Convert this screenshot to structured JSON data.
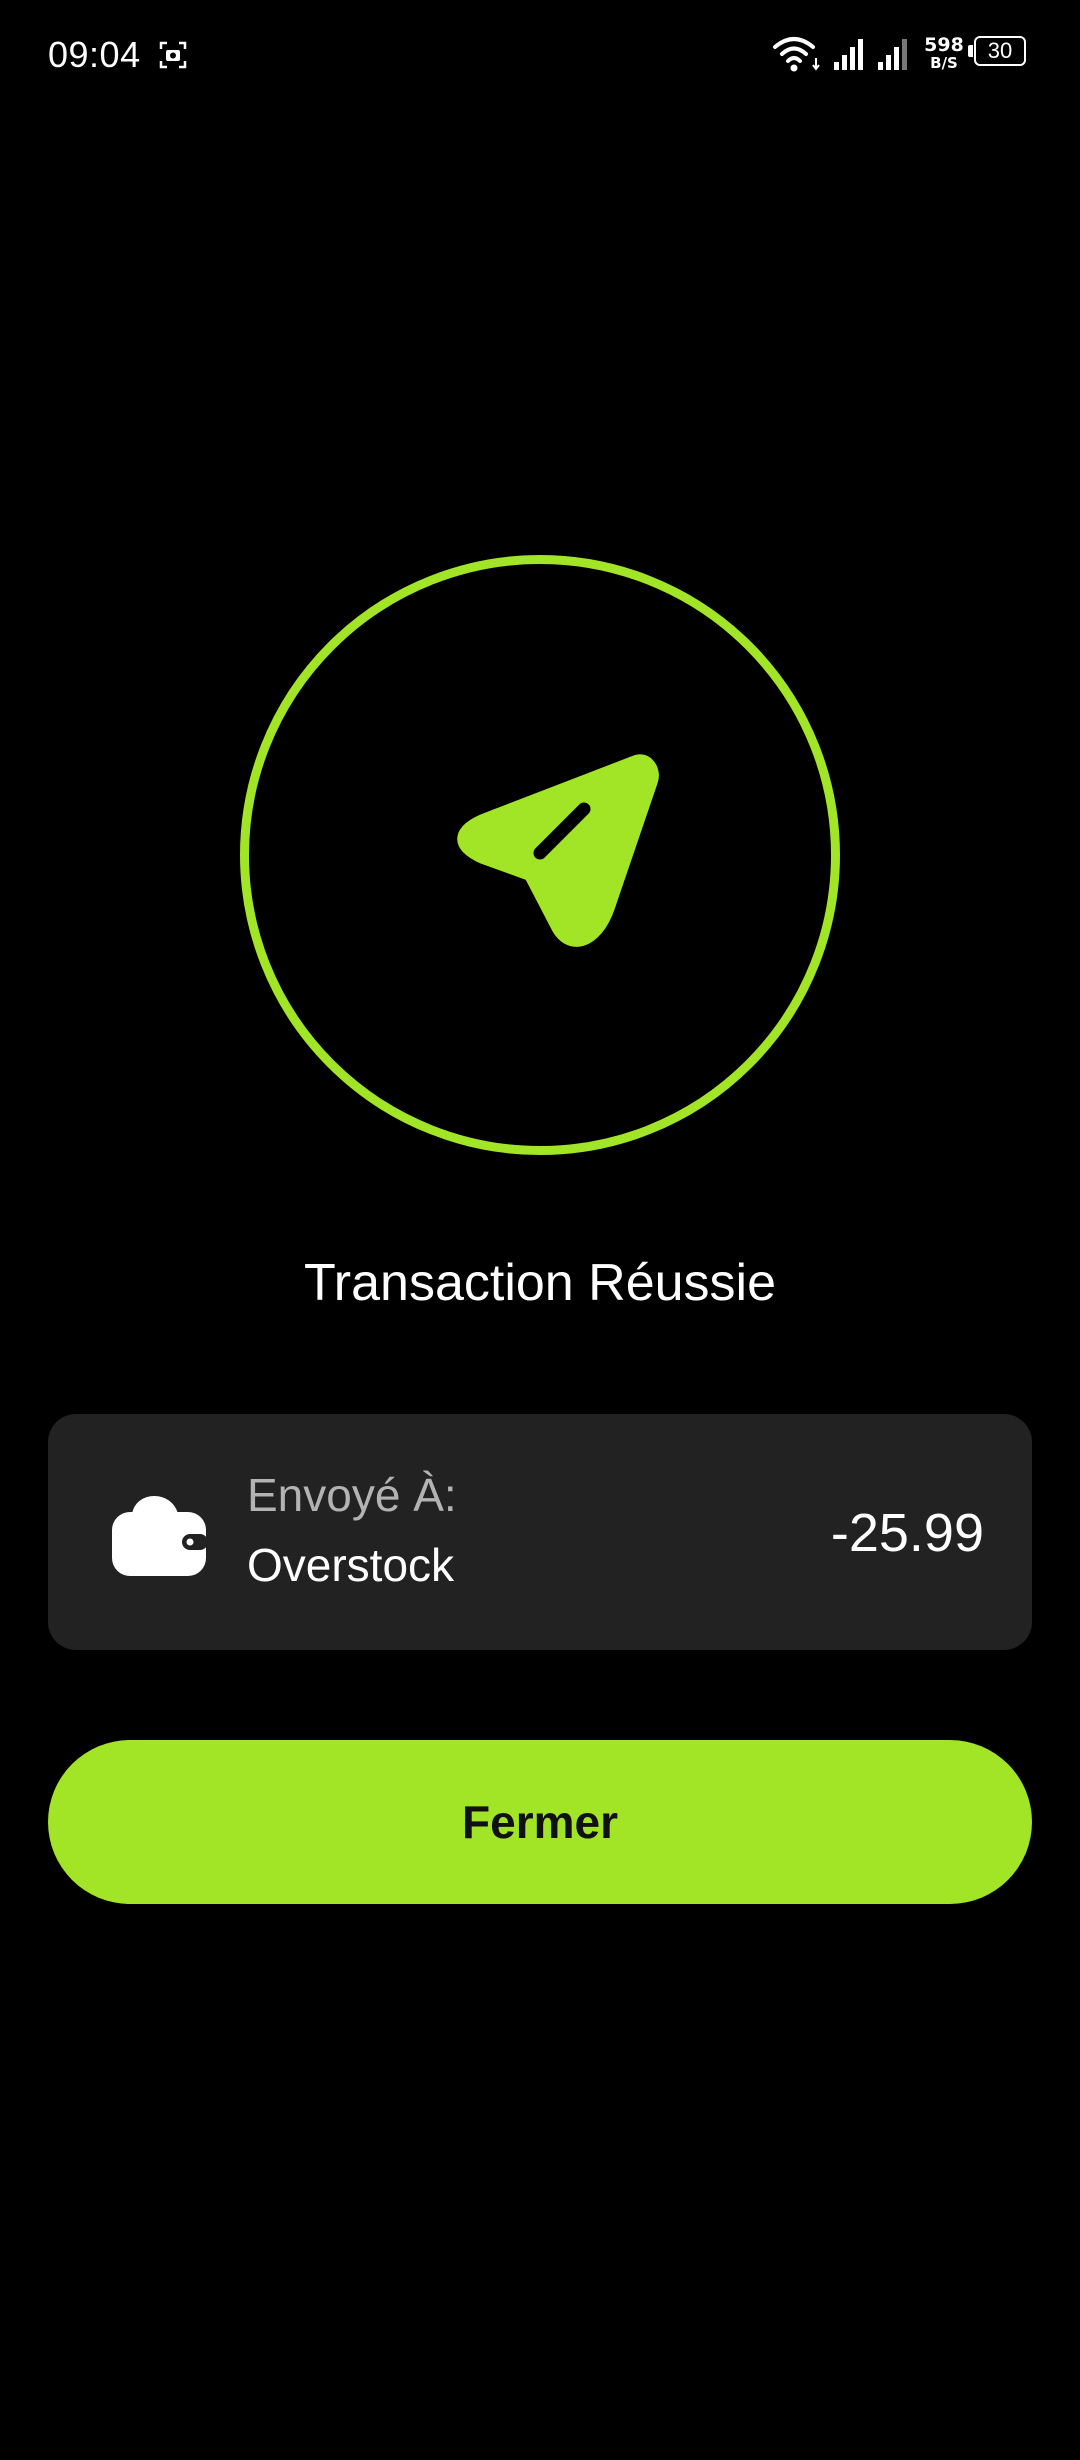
{
  "status_bar": {
    "time": "09:04",
    "network_speed_value": "598",
    "network_speed_unit": "B/S",
    "battery_level": "30",
    "icons": [
      "screenshot-icon",
      "wifi-icon",
      "signal-icon",
      "signal-icon",
      "battery-icon"
    ]
  },
  "hero": {
    "icon": "send-arrow-icon"
  },
  "result": {
    "title": "Transaction Réussie"
  },
  "transaction": {
    "icon": "wallet-icon",
    "label": "Envoyé À:",
    "recipient": "Overstock",
    "amount": "-25.99"
  },
  "actions": {
    "close_label": "Fermer"
  },
  "colors": {
    "background": "#000000",
    "accent": "#a2e426",
    "card": "#222222",
    "muted_text": "#b3b3b3"
  }
}
